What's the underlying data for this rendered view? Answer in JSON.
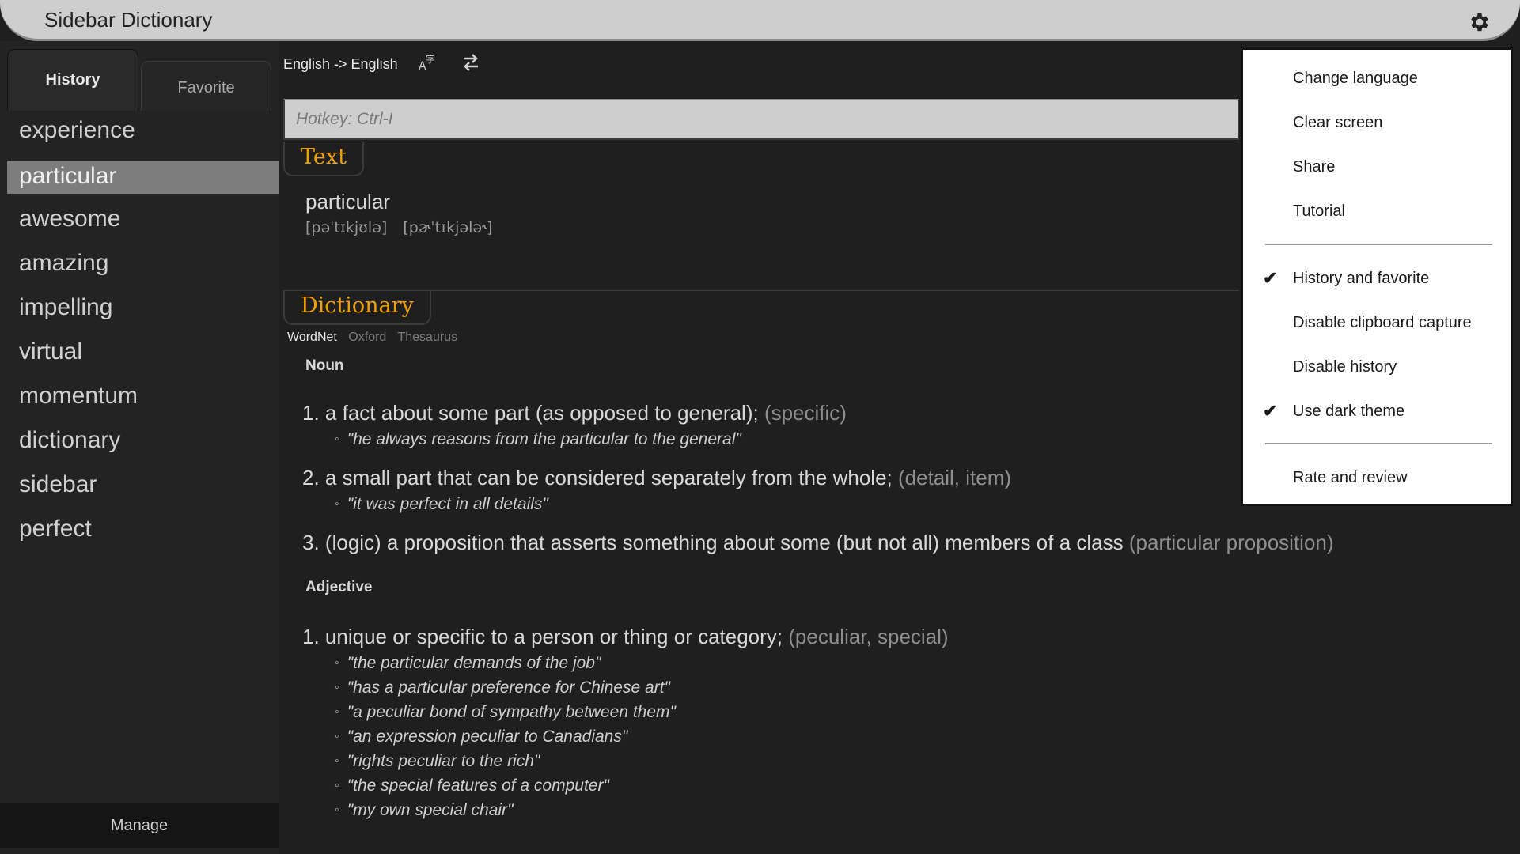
{
  "app": {
    "title": "Sidebar Dictionary",
    "settings_icon": "gear-icon"
  },
  "sidebar": {
    "tabs": [
      {
        "label": "History",
        "active": true
      },
      {
        "label": "Favorite",
        "active": false
      }
    ],
    "history": [
      "experience",
      "particular",
      "awesome",
      "amazing",
      "impelling",
      "virtual",
      "momentum",
      "dictionary",
      "sidebar",
      "perfect"
    ],
    "selected": "particular",
    "manage_label": "Manage"
  },
  "toolbar": {
    "language": "English -> English",
    "translate_icon": "translate-icon",
    "swap_icon": "swap-icon"
  },
  "search": {
    "value": "",
    "placeholder": "Hotkey: Ctrl-I"
  },
  "text_section": {
    "label": "Text",
    "word": "particular",
    "phonetics": [
      "[pəˈtɪkjʊlə]",
      "[pɚˈtɪkjələ˞]"
    ]
  },
  "dictionary_section": {
    "label": "Dictionary",
    "sources": [
      {
        "label": "WordNet",
        "active": true
      },
      {
        "label": "Oxford",
        "active": false
      },
      {
        "label": "Thesaurus",
        "active": false
      }
    ],
    "noun": {
      "label": "Noun",
      "defs": [
        {
          "num": "1.",
          "text": "a fact about some part (as opposed to general);",
          "syn": "(specific)",
          "examples": [
            "\"he always reasons from the particular to the general\""
          ]
        },
        {
          "num": "2.",
          "text": "a small part that can be considered separately from the whole;",
          "syn": "(detail, item)",
          "examples": [
            "\"it was perfect in all details\""
          ]
        },
        {
          "num": "3.",
          "text": "(logic) a proposition that asserts something about some (but not all) members of a class",
          "syn": "(particular proposition)",
          "examples": []
        }
      ]
    },
    "adjective": {
      "label": "Adjective",
      "defs": [
        {
          "num": "1.",
          "text": "unique or specific to a person or thing or category;",
          "syn": "(peculiar, special)",
          "examples": [
            "\"the particular demands of the job\"",
            "\"has a particular preference for Chinese art\"",
            "\"a peculiar bond of sympathy between them\"",
            "\"an expression peculiar to Canadians\"",
            "\"rights peculiar to the rich\"",
            "\"the special features of a computer\"",
            "\"my own special chair\""
          ]
        }
      ]
    }
  },
  "menu": {
    "items": [
      {
        "label": "Change language",
        "checked": false
      },
      {
        "label": "Clear screen",
        "checked": false
      },
      {
        "label": "Share",
        "checked": false
      },
      {
        "label": "Tutorial",
        "checked": false
      },
      {
        "label": "History and favorite",
        "checked": true
      },
      {
        "label": "Disable clipboard capture",
        "checked": false
      },
      {
        "label": "Disable history",
        "checked": false
      },
      {
        "label": "Use dark theme",
        "checked": true
      },
      {
        "label": "Rate and review",
        "checked": false
      }
    ]
  },
  "colors": {
    "accent": "#f0a000",
    "titlebar": "#cecece",
    "background": "#1f1f1f",
    "selected_item": "#7d7d7d"
  }
}
